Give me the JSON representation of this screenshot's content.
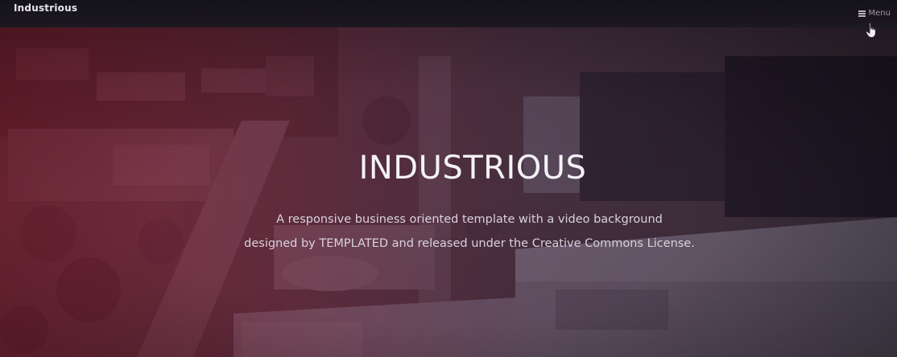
{
  "header": {
    "brand": "Industrious",
    "menu_label": "Menu",
    "menu_icon": "hamburger-icon"
  },
  "banner": {
    "title": "INDUSTRIOUS",
    "text_line_1": "A responsive business oriented template with a video background",
    "text_line_2": "designed by TEMPLATED and released under the Creative Commons License."
  },
  "colors": {
    "overlay_red": "#961e32",
    "header_bg": "#15131a",
    "title_text": "#f4f2f5",
    "body_text": "#d9d3dc"
  }
}
